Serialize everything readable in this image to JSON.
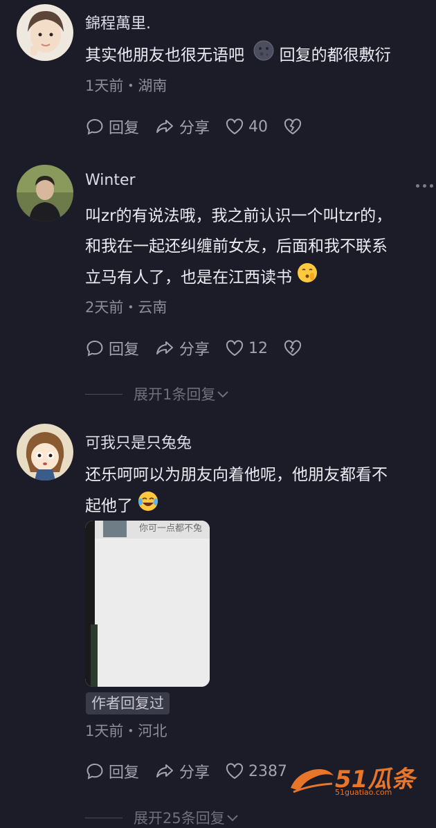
{
  "comments": [
    {
      "username": "錦程萬里.",
      "text_lines": [
        "其实他朋友也很无语吧",
        "回复的都很敷衍"
      ],
      "emoji": "moon-face-emoji",
      "meta": "1天前・湖南",
      "actions": {
        "reply": "回复",
        "share": "分享",
        "likes": "40"
      }
    },
    {
      "username": "Winter",
      "text_lines": [
        "叫zr的有说法哦，我之前认识一个叫tzr的，",
        "和我在一起还纠缠前女友，后面和我不联系",
        "立马有人了，也是在江西读书"
      ],
      "emoji": "shushing-face-emoji",
      "meta": "2天前・云南",
      "actions": {
        "reply": "回复",
        "share": "分享",
        "likes": "12"
      },
      "expand_label": "展开1条回复"
    },
    {
      "username": "可我只是只兔兔",
      "text_lines": [
        "还乐呵呵以为朋友向着他呢，他朋友都看不",
        "起他了"
      ],
      "emoji": "laughing-crying-emoji",
      "image_caption": "你可一点都不兔",
      "badge": "作者回复过",
      "meta": "1天前・河北",
      "actions": {
        "reply": "回复",
        "share": "分享",
        "likes": "2387"
      },
      "expand_label": "展开25条回复"
    }
  ],
  "watermark": {
    "brand": "51瓜条",
    "url": "51guatiao.com"
  },
  "colors": {
    "background": "#1b1c27",
    "meta": "#8c8d99",
    "accent": "#e8762a"
  }
}
